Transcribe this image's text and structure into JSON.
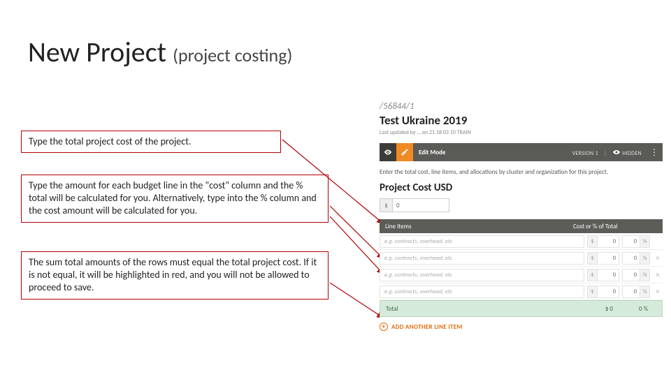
{
  "title_main": "New Project",
  "title_sub": "(project costing)",
  "callouts": {
    "c1": "Type the total project cost of the project.",
    "c2": "Type the amount for each budget line in the \"cost\" column and the % total will be calculated for you.  Alternatively, type into the % column and the cost amount will be calculated for you.",
    "c3": "The sum total amounts of the rows must equal the total project cost.  If it is not equal, it will be highlighted in red, and you will not be allowed to proceed to save."
  },
  "screenshot": {
    "path": "/56844/1",
    "project_name": "Test Ukraine 2019",
    "updated": "Last updated by … on 21.18 03 10 TRAIN",
    "titlebar": {
      "edit": "Edit Mode",
      "version": "VERSION 1",
      "hidden": "HIDDEN"
    },
    "instructions": "Enter the total cost, line items, and allocations by cluster and organization for this project.",
    "cost_heading": "Project Cost USD",
    "cost_value": "0",
    "table": {
      "head_line": "Line Items",
      "head_cost": "Cost or % of Total",
      "placeholder": "e.g. contracts, overhead, etc",
      "zero": "0",
      "pct": "%",
      "dollar": "$",
      "total_label": "Total",
      "total_cost": "$ 0",
      "total_pct": "0 %"
    },
    "add_label": "ADD ANOTHER LINE ITEM"
  }
}
